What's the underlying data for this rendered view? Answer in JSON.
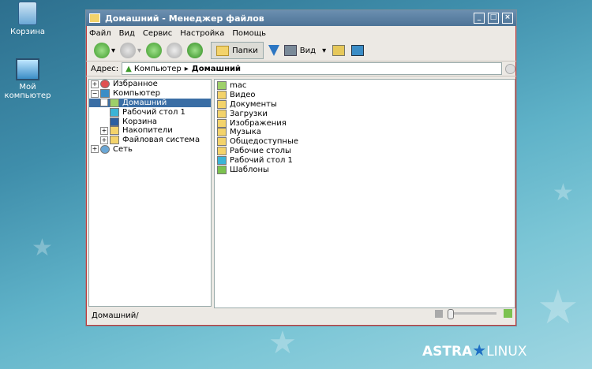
{
  "desktop": {
    "trash_label": "Корзина",
    "computer_label": "Мой\nкомпьютер"
  },
  "window": {
    "title": "Домашний - Менеджер файлов",
    "menu": [
      "Файл",
      "Вид",
      "Сервис",
      "Настройка",
      "Помощь"
    ],
    "toolbar": {
      "folders_label": "Папки",
      "view_label": "Вид"
    },
    "address": {
      "label": "Адрес:",
      "segment1": "Компьютер",
      "segment2": "Домашний"
    },
    "tree": [
      {
        "label": "Избранное",
        "expander": "+"
      },
      {
        "label": "Компьютер",
        "expander": "−"
      },
      {
        "label": "Домашний",
        "expander": "+"
      },
      {
        "label": "Рабочий стол 1"
      },
      {
        "label": "Корзина"
      },
      {
        "label": "Накопители",
        "expander": "+"
      },
      {
        "label": "Файловая система",
        "expander": "+"
      },
      {
        "label": "Сеть",
        "expander": "+"
      }
    ],
    "files": [
      "mac",
      "Видео",
      "Документы",
      "Загрузки",
      "Изображения",
      "Музыка",
      "Общедоступные",
      "Рабочие столы",
      "Рабочий стол 1",
      "Шаблоны"
    ],
    "status": "Домашний/"
  },
  "logo": {
    "astra": "ASTRA",
    "linux": "LINUX"
  },
  "colors": {
    "selection": "#3a6ea5",
    "titlebar": "#4d7396",
    "folder": "#f3d36b"
  }
}
